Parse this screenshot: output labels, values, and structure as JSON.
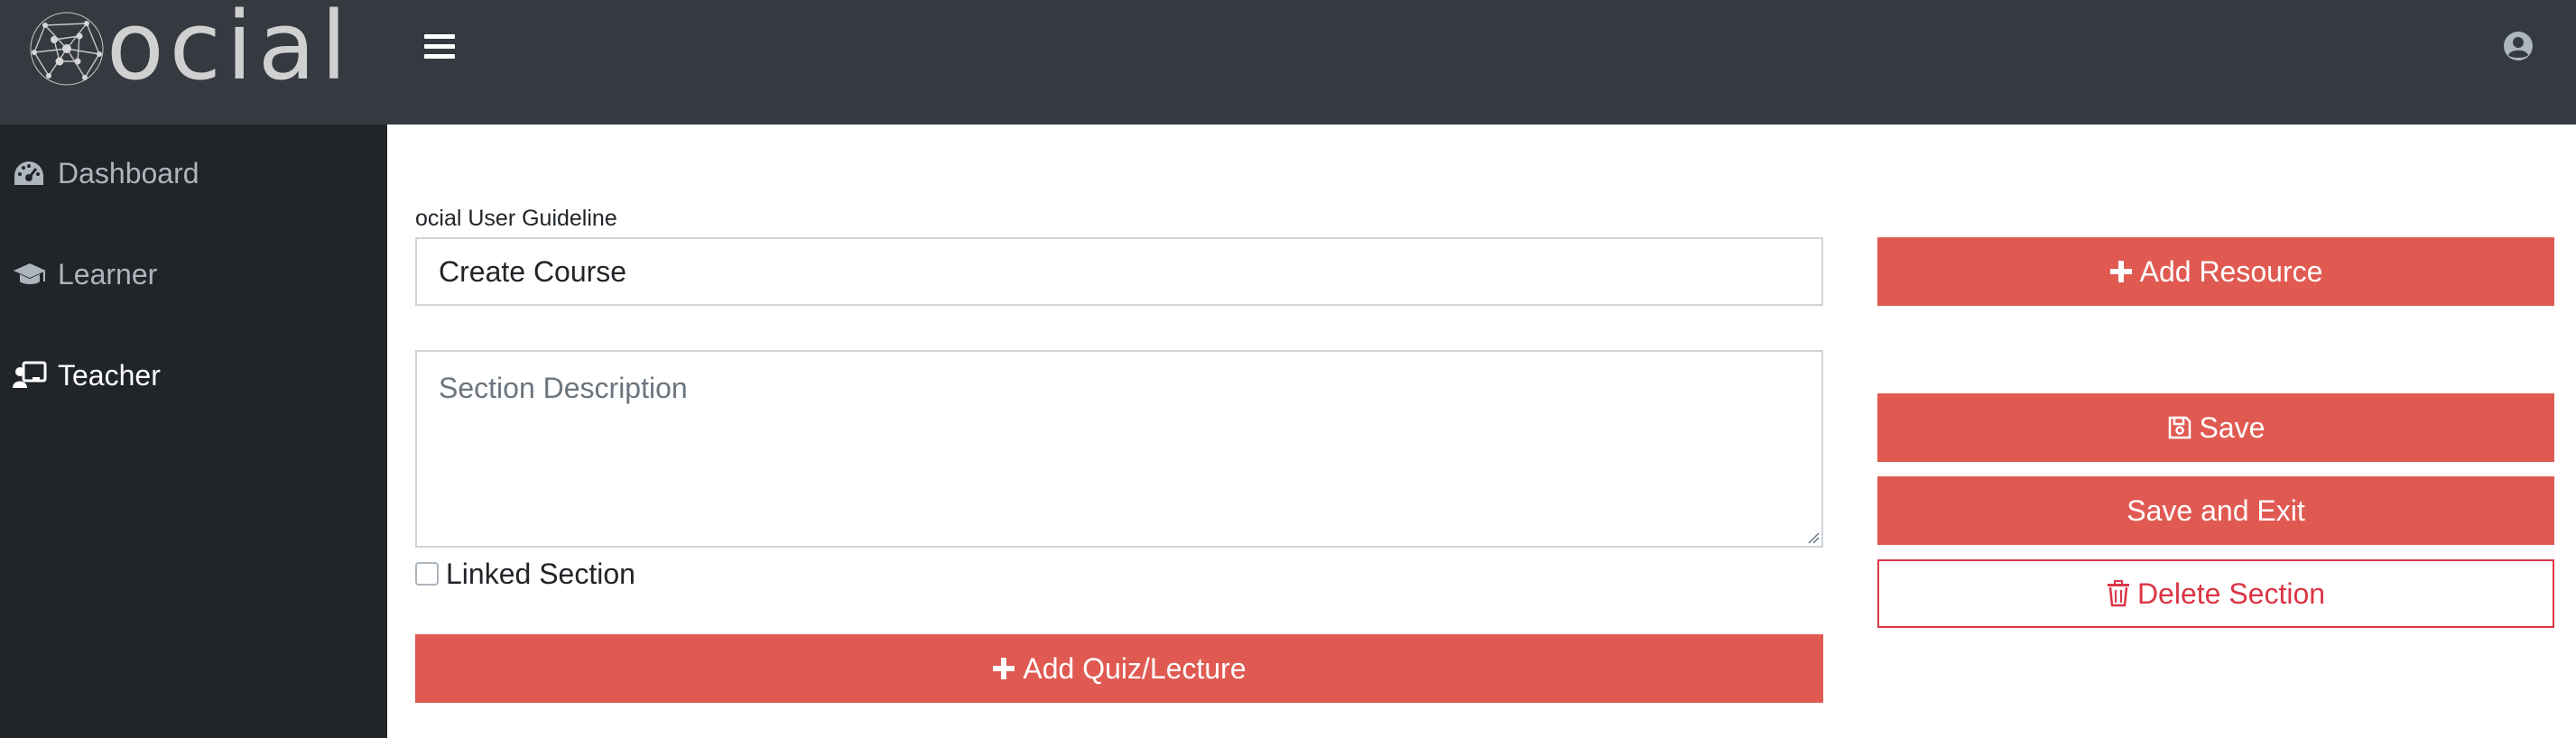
{
  "brand": {
    "logo_text": "ocial"
  },
  "header": {
    "menu_icon": "hamburger-icon",
    "user_icon": "user-circle-icon"
  },
  "sidebar": {
    "items": [
      {
        "label": "Dashboard",
        "icon": "tachometer-icon",
        "active": false
      },
      {
        "label": "Learner",
        "icon": "graduation-cap-icon",
        "active": false
      },
      {
        "label": "Teacher",
        "icon": "chalkboard-teacher-icon",
        "active": true
      }
    ]
  },
  "form": {
    "course_label": "ocial User Guideline",
    "course_value": "Create Course",
    "description_placeholder": "Section Description",
    "linked_section_label": "Linked Section",
    "linked_section_checked": false
  },
  "buttons": {
    "add_quiz": "Add Quiz/Lecture",
    "add_resource": "Add Resource",
    "save": "Save",
    "save_exit": "Save and Exit",
    "delete_section": "Delete Section"
  },
  "colors": {
    "topbar": "#343a40",
    "sidebar": "#212529",
    "accent": "#e05a52",
    "danger_outline": "#dc3545"
  }
}
